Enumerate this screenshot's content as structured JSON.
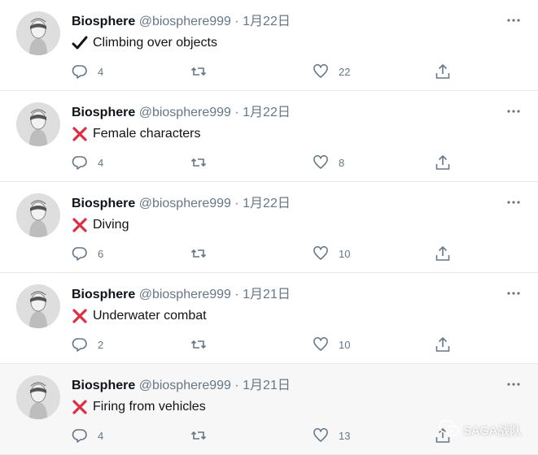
{
  "tweets": [
    {
      "name": "Biosphere",
      "handle": "@biosphere999",
      "date": "1月22日",
      "status": "check",
      "text": "Climbing over objects",
      "replies": "4",
      "likes": "22"
    },
    {
      "name": "Biosphere",
      "handle": "@biosphere999",
      "date": "1月22日",
      "status": "cross",
      "text": "Female characters",
      "replies": "4",
      "likes": "8"
    },
    {
      "name": "Biosphere",
      "handle": "@biosphere999",
      "date": "1月22日",
      "status": "cross",
      "text": "Diving",
      "replies": "6",
      "likes": "10"
    },
    {
      "name": "Biosphere",
      "handle": "@biosphere999",
      "date": "1月21日",
      "status": "cross",
      "text": "Underwater combat",
      "replies": "2",
      "likes": "10"
    },
    {
      "name": "Biosphere",
      "handle": "@biosphere999",
      "date": "1月21日",
      "status": "cross",
      "text": "Firing from vehicles",
      "replies": "4",
      "likes": "13"
    }
  ],
  "separator": "·",
  "watermark": {
    "text": "SAGA战队"
  },
  "colors": {
    "cross": "#dd2e44",
    "check": "#0f1419",
    "muted": "#657786",
    "highlight": "#f7f7f7"
  },
  "icons": {
    "avatar": "avatar-portrait",
    "more": "more-icon",
    "reply": "reply-icon",
    "retweet": "retweet-icon",
    "like": "heart-icon",
    "share": "share-icon",
    "check": "check-mark-icon",
    "cross": "cross-mark-icon"
  }
}
